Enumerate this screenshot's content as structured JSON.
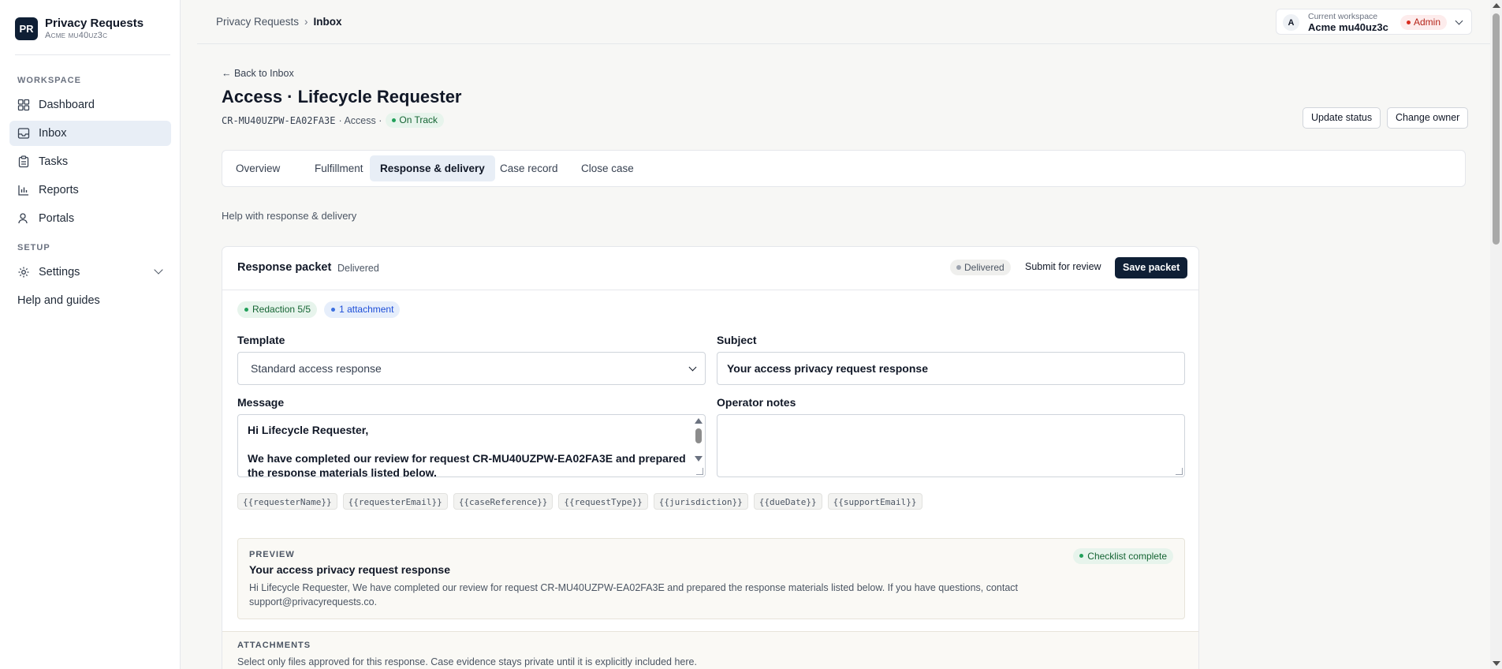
{
  "brand": {
    "logo": "PR",
    "title": "Privacy Requests",
    "subtitle": "Acme mu40uz3c"
  },
  "sidebar": {
    "workspace_label": "WORKSPACE",
    "items": [
      {
        "label": "Dashboard",
        "icon": "dashboard-icon"
      },
      {
        "label": "Inbox",
        "icon": "inbox-icon",
        "active": true
      },
      {
        "label": "Tasks",
        "icon": "clipboard-icon"
      },
      {
        "label": "Reports",
        "icon": "bar-chart-icon"
      },
      {
        "label": "Portals",
        "icon": "user-icon"
      }
    ],
    "setup_label": "SETUP",
    "settings_label": "Settings",
    "help_label": "Help and guides"
  },
  "breadcrumb": {
    "root": "Privacy Requests",
    "separator": "›",
    "current": "Inbox"
  },
  "workspace": {
    "avatar": "A",
    "label": "Current workspace",
    "name": "Acme mu40uz3c",
    "role": "Admin"
  },
  "header": {
    "back_label": "← Back to Inbox",
    "title": "Access · Lifecycle Requester",
    "reference": "CR-MU40UZPW-EA02FA3E",
    "type": "· Access ·",
    "status": "On Track",
    "update_status_label": "Update status",
    "change_owner_label": "Change owner"
  },
  "tabs": [
    "Overview",
    "Fulfillment",
    "Response & delivery",
    "Case record",
    "Close case"
  ],
  "active_tab": "Response & delivery",
  "help_text": "Help with response & delivery",
  "packet": {
    "title": "Response packet",
    "subtitle": "Delivered",
    "status_pill": "Delivered",
    "submit_label": "Submit for review",
    "save_label": "Save packet",
    "badges": {
      "redaction": "Redaction 5/5",
      "attachments": "1 attachment"
    },
    "template_label": "Template",
    "template_value": "Standard access response",
    "subject_label": "Subject",
    "subject_value": "Your access privacy request response",
    "message_label": "Message",
    "message_value": "Hi Lifecycle Requester,\n\nWe have completed our review for request CR-MU40UZPW-EA02FA3E and prepared the response materials listed below.",
    "notes_label": "Operator notes",
    "notes_value": "",
    "tokens": [
      "{{requesterName}}",
      "{{requesterEmail}}",
      "{{caseReference}}",
      "{{requestType}}",
      "{{jurisdiction}}",
      "{{dueDate}}",
      "{{supportEmail}}"
    ]
  },
  "preview": {
    "label": "PREVIEW",
    "subject": "Your access privacy request response",
    "body": "Hi Lifecycle Requester, We have completed our review for request CR-MU40UZPW-EA02FA3E and prepared the response materials listed below. If you have questions, contact support@privacyrequests.co.",
    "checklist": "Checklist complete"
  },
  "attachments": {
    "label": "ATTACHMENTS",
    "description": "Select only files approved for this response. Case evidence stays private until it is explicitly included here."
  },
  "colors": {
    "primary": "#0f1f35",
    "active_bg": "#e8eef6",
    "success": "#22a05a",
    "danger": "#d92d20"
  }
}
